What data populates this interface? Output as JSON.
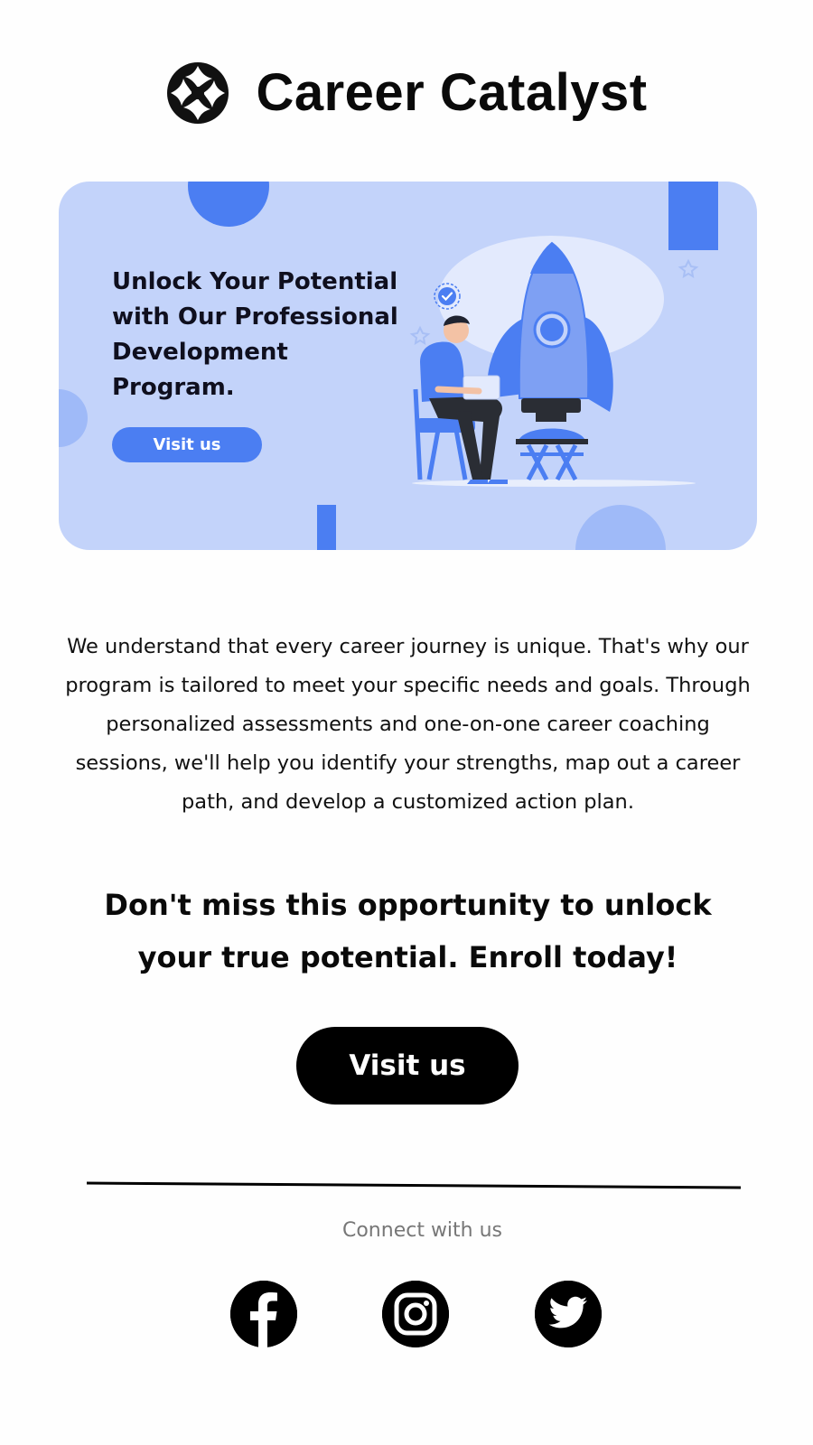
{
  "brand": {
    "name": "Career Catalyst",
    "logo_icon": "hands-circle-logo"
  },
  "hero": {
    "title": "Unlock Your Potential with Our Professional Development Program.",
    "button_label": "Visit us",
    "illustration_icon": "person-laptop-rocket-illustration",
    "colors": {
      "background": "#c3d3fa",
      "accent": "#4b7ef2"
    }
  },
  "body": {
    "paragraph": "We understand that every career journey is unique. That's why our program is tailored to meet your specific needs and goals. Through personalized assessments and one-on-one career coaching sessions, we'll help you identify your strengths, map out a career path, and develop a customized action plan."
  },
  "cta": {
    "heading": "Don't miss this opportunity to unlock your true potential. Enroll today!",
    "button_label": "Visit us"
  },
  "footer": {
    "connect_label": "Connect with us",
    "social": [
      {
        "name": "facebook",
        "icon": "facebook-icon"
      },
      {
        "name": "instagram",
        "icon": "instagram-icon"
      },
      {
        "name": "twitter",
        "icon": "twitter-icon"
      }
    ]
  }
}
